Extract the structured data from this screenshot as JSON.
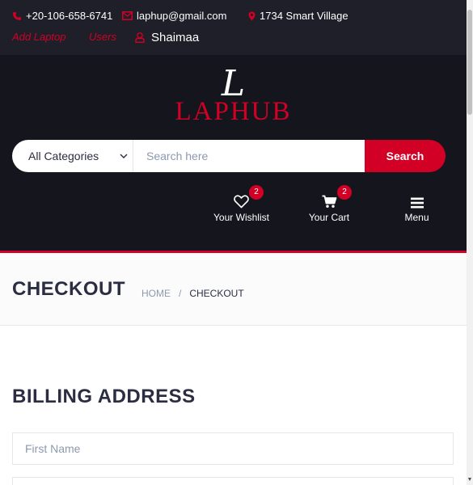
{
  "topbar": {
    "phone": "+20-106-658-6741",
    "email": "laphup@gmail.com",
    "address": "1734 Smart Village",
    "add_laptop": "Add Laptop",
    "users": "Users",
    "username": "Shaimaa"
  },
  "header": {
    "logo_glyph": "L",
    "logo_text": "LAPHUB",
    "category_select": "All Categories",
    "search_placeholder": "Search here",
    "search_button": "Search",
    "wishlist_label": "Your Wishlist",
    "wishlist_count": "2",
    "cart_label": "Your Cart",
    "cart_count": "2",
    "menu_label": "Menu"
  },
  "breadcrumb": {
    "title": "CHECKOUT",
    "home": "HOME",
    "separator": "/",
    "current": "CHECKOUT"
  },
  "billing": {
    "title": "BILLING ADDRESS",
    "first_name_placeholder": "First Name"
  },
  "colors": {
    "accent": "#d10024",
    "topbar_bg": "#1e1f29",
    "header_bg": "#15161d",
    "text_dark": "#2b2d42",
    "muted": "#8d99ae"
  }
}
